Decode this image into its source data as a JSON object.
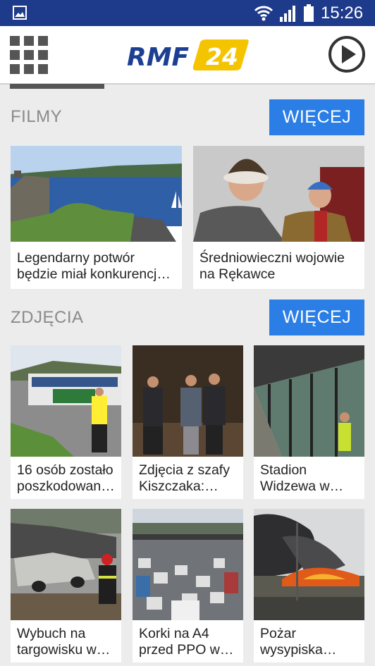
{
  "status_bar": {
    "time": "15:26"
  },
  "header": {
    "logo_text_left": "RMF",
    "logo_text_right": "24"
  },
  "sections": [
    {
      "title": "FILMY",
      "more_label": "WIĘCEJ",
      "items": [
        {
          "caption": "Legendarny potwór\nbędzie miał konkurencj…"
        },
        {
          "caption": "Średniowieczni wojowie\nna Rękawce"
        }
      ]
    },
    {
      "title": "ZDJĘCIA",
      "more_label": "WIĘCEJ",
      "items": [
        {
          "caption": "16 osób zostało\nposzkodowan…"
        },
        {
          "caption": "Zdjęcia z szafy\nKiszczaka:…"
        },
        {
          "caption": "Stadion\nWidzewa w…"
        },
        {
          "caption": "Wybuch na\ntargowisku w…"
        },
        {
          "caption": "Korki na A4\nprzed PPO w…"
        },
        {
          "caption": "Pożar\nwysypiska…"
        }
      ]
    }
  ],
  "colors": {
    "status_bar": "#1e3a8a",
    "accent": "#2a7ee6",
    "logo_blue": "#1c3f94",
    "logo_yellow": "#f5c400"
  }
}
